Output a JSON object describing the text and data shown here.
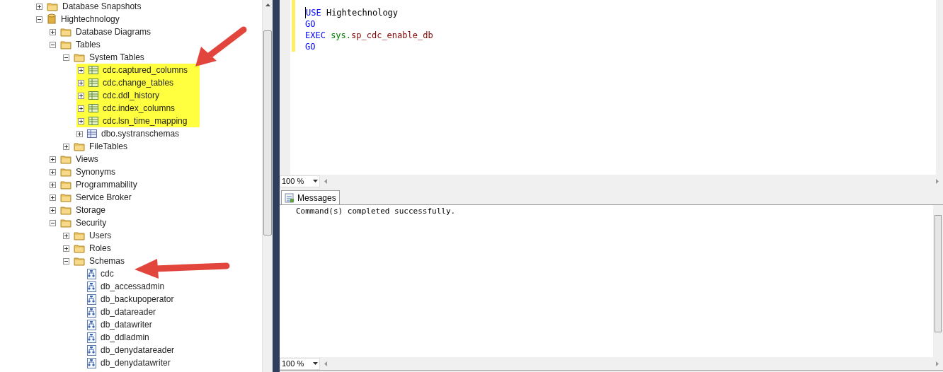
{
  "object_explorer": {
    "items": [
      {
        "label": "Database Snapshots",
        "kind": "folder",
        "expanded": false,
        "highlighted": false
      },
      {
        "label": "Hightechnology",
        "kind": "database",
        "expanded": true,
        "highlighted": false,
        "children": [
          {
            "label": "Database Diagrams",
            "kind": "folder",
            "expanded": false,
            "highlighted": false
          },
          {
            "label": "Tables",
            "kind": "folder",
            "expanded": true,
            "highlighted": false,
            "children": [
              {
                "label": "System Tables",
                "kind": "folder",
                "expanded": true,
                "highlighted": false,
                "children": [
                  {
                    "label": "cdc.captured_columns",
                    "kind": "table",
                    "expanded": false,
                    "highlighted": true
                  },
                  {
                    "label": "cdc.change_tables",
                    "kind": "table",
                    "expanded": false,
                    "highlighted": true
                  },
                  {
                    "label": "cdc.ddl_history",
                    "kind": "table",
                    "expanded": false,
                    "highlighted": true
                  },
                  {
                    "label": "cdc.index_columns",
                    "kind": "table",
                    "expanded": false,
                    "highlighted": true
                  },
                  {
                    "label": "cdc.lsn_time_mapping",
                    "kind": "table",
                    "expanded": false,
                    "highlighted": true
                  },
                  {
                    "label": "dbo.systranschemas",
                    "kind": "system-table",
                    "expanded": false,
                    "highlighted": false
                  }
                ]
              },
              {
                "label": "FileTables",
                "kind": "folder",
                "expanded": false,
                "highlighted": false
              }
            ]
          },
          {
            "label": "Views",
            "kind": "folder",
            "expanded": false,
            "highlighted": false
          },
          {
            "label": "Synonyms",
            "kind": "folder",
            "expanded": false,
            "highlighted": false
          },
          {
            "label": "Programmability",
            "kind": "folder",
            "expanded": false,
            "highlighted": false
          },
          {
            "label": "Service Broker",
            "kind": "folder",
            "expanded": false,
            "highlighted": false
          },
          {
            "label": "Storage",
            "kind": "folder",
            "expanded": false,
            "highlighted": false
          },
          {
            "label": "Security",
            "kind": "folder",
            "expanded": true,
            "highlighted": false,
            "children": [
              {
                "label": "Users",
                "kind": "folder",
                "expanded": false,
                "highlighted": false
              },
              {
                "label": "Roles",
                "kind": "folder",
                "expanded": false,
                "highlighted": false
              },
              {
                "label": "Schemas",
                "kind": "folder",
                "expanded": true,
                "highlighted": false,
                "children": [
                  {
                    "label": "cdc",
                    "kind": "schema",
                    "highlighted": false
                  },
                  {
                    "label": "db_accessadmin",
                    "kind": "schema",
                    "highlighted": false
                  },
                  {
                    "label": "db_backupoperator",
                    "kind": "schema",
                    "highlighted": false
                  },
                  {
                    "label": "db_datareader",
                    "kind": "schema",
                    "highlighted": false
                  },
                  {
                    "label": "db_datawriter",
                    "kind": "schema",
                    "highlighted": false
                  },
                  {
                    "label": "db_ddladmin",
                    "kind": "schema",
                    "highlighted": false
                  },
                  {
                    "label": "db_denydatareader",
                    "kind": "schema",
                    "highlighted": false
                  },
                  {
                    "label": "db_denydatawriter",
                    "kind": "schema",
                    "highlighted": false
                  }
                ]
              }
            ]
          }
        ]
      }
    ]
  },
  "editor": {
    "lines": [
      [
        {
          "text": "USE",
          "kind": "keyword"
        },
        {
          "text": " Hightechnology",
          "kind": "plain"
        }
      ],
      [
        {
          "text": "GO",
          "kind": "keyword"
        }
      ],
      [
        {
          "text": "EXEC",
          "kind": "keyword"
        },
        {
          "text": " sys.",
          "kind": "schema"
        },
        {
          "text": "sp_cdc_enable_db",
          "kind": "procedure"
        }
      ],
      [
        {
          "text": "GO",
          "kind": "keyword"
        }
      ]
    ],
    "zoom": "100 %"
  },
  "results": {
    "tabs": [
      {
        "label": "Messages",
        "selected": true
      }
    ],
    "messages": [
      "Command(s) completed successfully."
    ],
    "zoom": "100 %"
  }
}
